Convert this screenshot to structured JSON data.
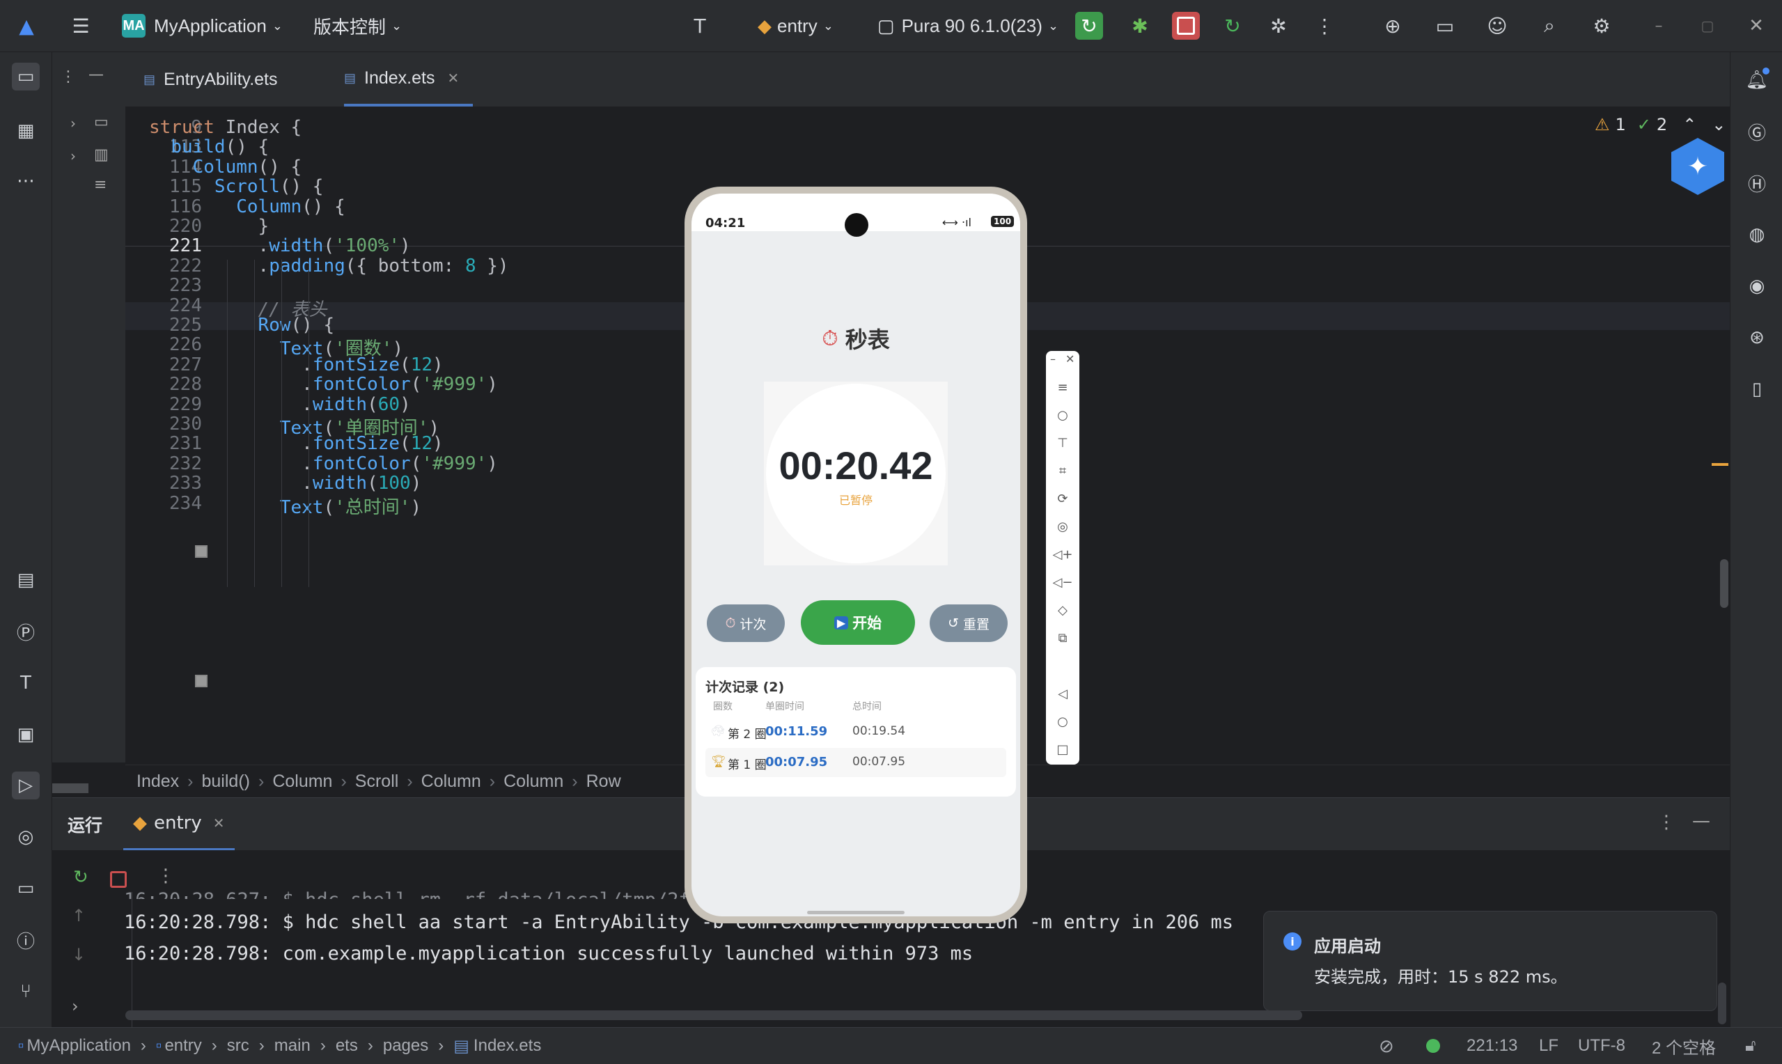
{
  "titlebar": {
    "project_badge": "MA",
    "project_name": "MyApplication",
    "vcs": "版本控制",
    "run_config": "entry",
    "device": "Pura 90 6.1.0(23)"
  },
  "tabs": [
    {
      "label": "EntryAbility.ets"
    },
    {
      "label": "Index.ets"
    }
  ],
  "editor": {
    "warnings": "1",
    "checks": "2",
    "lines": [
      {
        "n": "9",
        "text": "struct Index {"
      },
      {
        "n": "113",
        "text": "  build() {"
      },
      {
        "n": "114",
        "text": "    Column() {"
      },
      {
        "n": "115",
        "text": "      Scroll() {"
      },
      {
        "n": "116",
        "text": "        Column() {"
      },
      {
        "n": "220",
        "text": "          }"
      },
      {
        "n": "221",
        "text": "          .width('100%')"
      },
      {
        "n": "222",
        "text": "          .padding({ bottom: 8 })"
      },
      {
        "n": "223",
        "text": ""
      },
      {
        "n": "224",
        "text": "          // 表头"
      },
      {
        "n": "225",
        "text": "          Row() {"
      },
      {
        "n": "226",
        "text": "            Text('圈数')"
      },
      {
        "n": "227",
        "text": "              .fontSize(12)"
      },
      {
        "n": "228",
        "text": "              .fontColor('#999')"
      },
      {
        "n": "229",
        "text": "              .width(60)"
      },
      {
        "n": "230",
        "text": "            Text('单圈时间')"
      },
      {
        "n": "231",
        "text": "              .fontSize(12)"
      },
      {
        "n": "232",
        "text": "              .fontColor('#999')"
      },
      {
        "n": "233",
        "text": "              .width(100)"
      },
      {
        "n": "234",
        "text": "            Text('总时间')"
      }
    ]
  },
  "breadcrumb": [
    "Index",
    "build()",
    "Column",
    "Scroll",
    "Column",
    "Column",
    "Row"
  ],
  "run_panel": {
    "title": "运行",
    "tab": "entry",
    "console": [
      "16:20:28.798: $ hdc shell aa start -a EntryAbility -b com.example.myapplication -m entry in 206 ms",
      "16:20:28.798: com.example.myapplication successfully launched within 973 ms"
    ]
  },
  "notification": {
    "title": "应用启动",
    "body": "安装完成，用时：15 s 822 ms。"
  },
  "statusbar": {
    "path": [
      "MyApplication",
      "entry",
      "src",
      "main",
      "ets",
      "pages",
      "Index.ets"
    ],
    "position": "221:13",
    "line_ending": "LF",
    "encoding": "UTF-8",
    "indent": "2 个空格"
  },
  "phone": {
    "time": "04:21",
    "battery": "100",
    "app_title": "秒表",
    "elapsed": "00:20.42",
    "state": "已暂停",
    "buttons": {
      "lap": "计次",
      "start": "开始",
      "reset": "重置"
    },
    "records_title": "计次记录 (2)",
    "headers": [
      "圈数",
      "单圈时间",
      "总时间"
    ],
    "laps": [
      {
        "lap": "第 2 圈",
        "split": "00:11.59",
        "total": "00:19.54"
      },
      {
        "lap": "第 1 圈",
        "split": "00:07.95",
        "total": "00:07.95"
      }
    ]
  },
  "colors": {
    "accent_green": "#3d9a4c",
    "stop_red": "#c94f4f",
    "phone_start": "#3aa54a",
    "phone_gray": "#7c8d9c",
    "split_blue": "#2b6cc4"
  }
}
